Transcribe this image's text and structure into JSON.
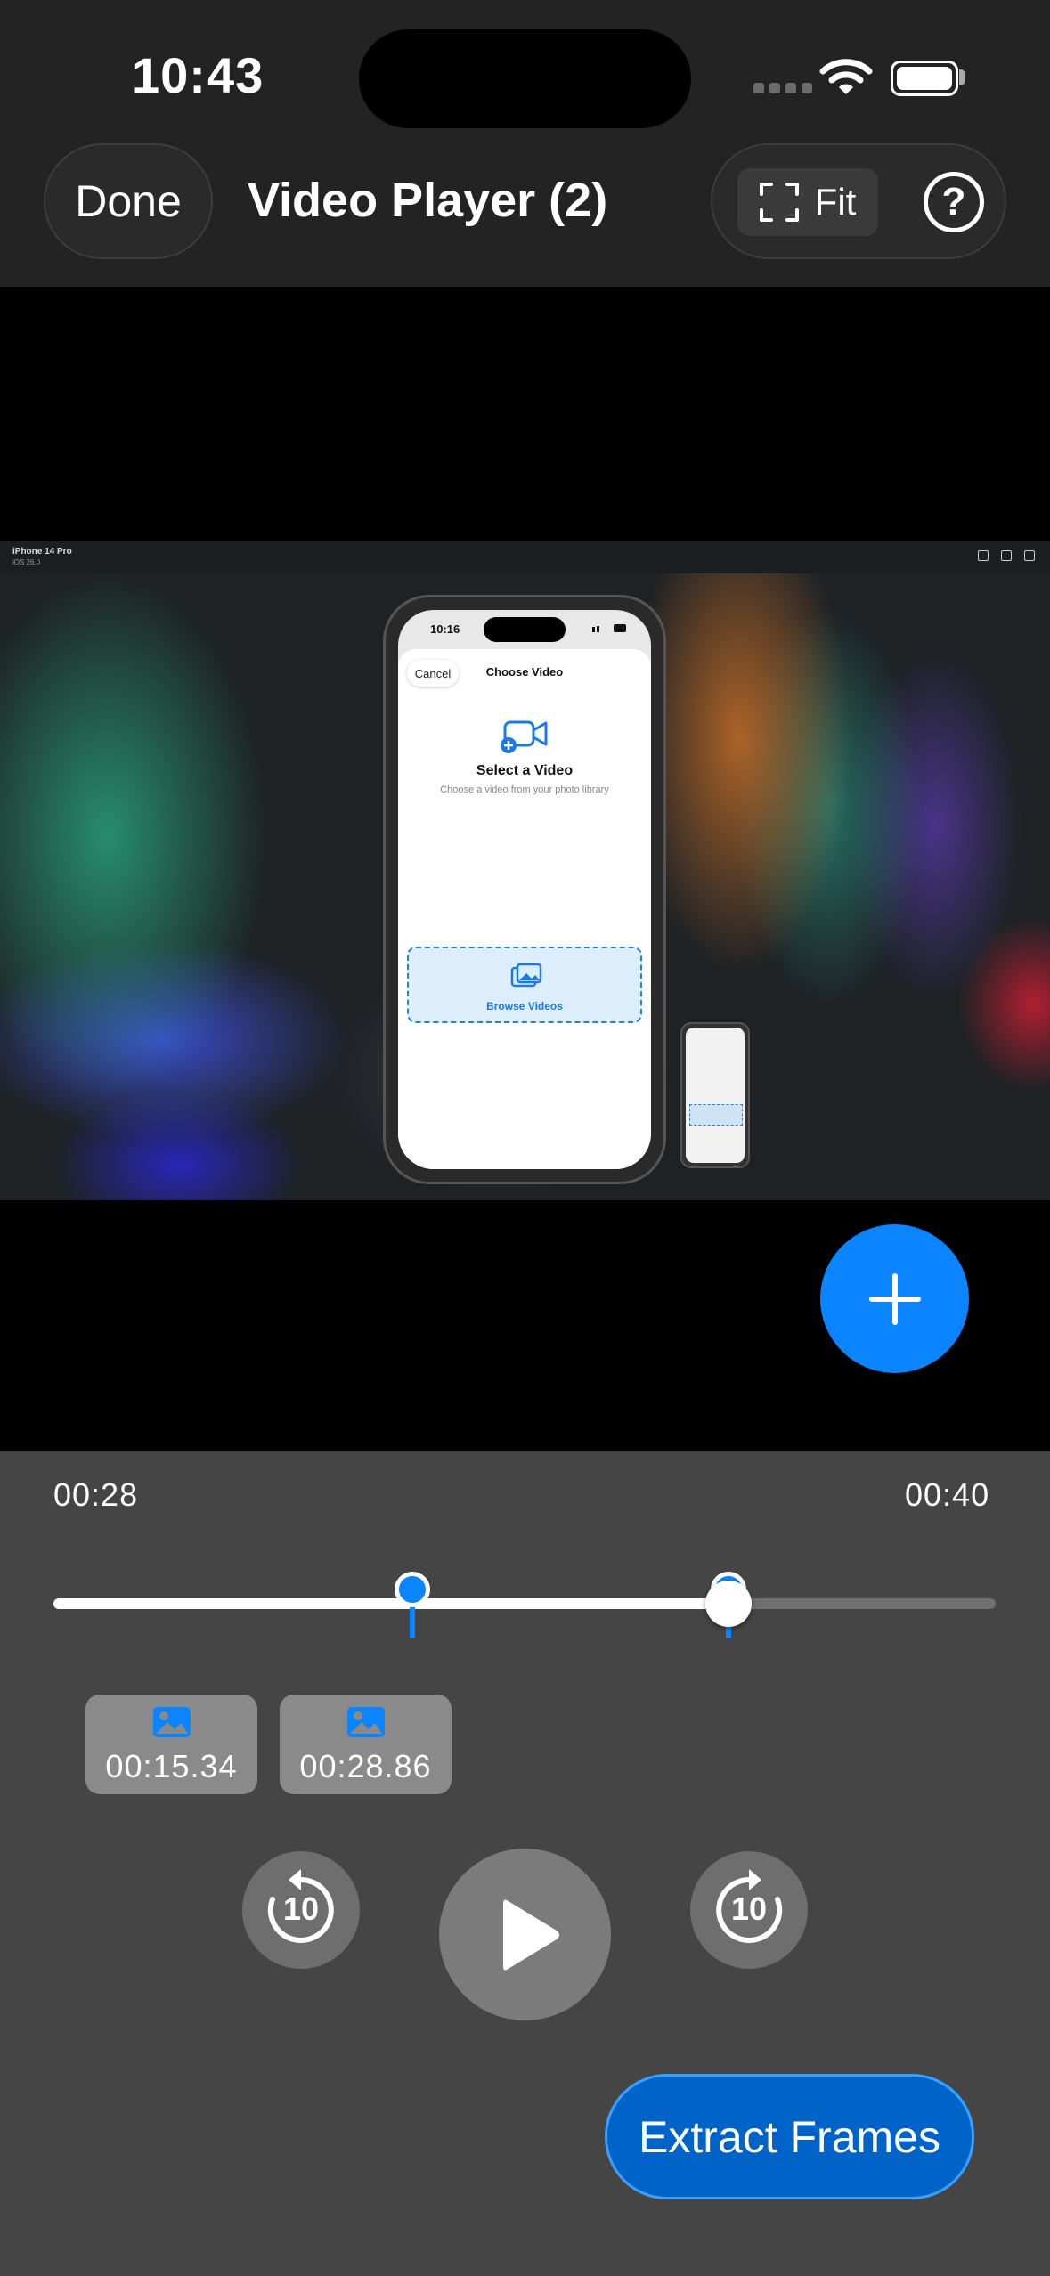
{
  "status_bar": {
    "time": "10:43"
  },
  "header": {
    "done_label": "Done",
    "title": "Video Player (2)",
    "fit_label": "Fit",
    "help_label": "?"
  },
  "video_frame": {
    "device_label": "iPhone 14 Pro",
    "os_label": "iOS 26.0",
    "phone": {
      "time": "10:16",
      "cancel_label": "Cancel",
      "sheet_title": "Choose Video",
      "heading": "Select a Video",
      "subheading": "Choose a video from your photo library",
      "browse_label": "Browse Videos"
    }
  },
  "add_button": {
    "icon": "plus-icon"
  },
  "timeline": {
    "current_time": "00:28",
    "total_time": "00:40",
    "progress_fraction": 0.7,
    "markers": [
      {
        "time": "00:15.34",
        "fraction": 0.38
      },
      {
        "time": "00:28.86",
        "fraction": 0.72
      }
    ]
  },
  "frames": [
    {
      "label": "00:15.34",
      "icon": "photo-icon"
    },
    {
      "label": "00:28.86",
      "icon": "photo-icon"
    }
  ],
  "playback": {
    "skip_back_label": "10",
    "skip_forward_label": "10",
    "play_icon": "play-icon"
  },
  "extract_label": "Extract Frames",
  "colors": {
    "accent": "#0a84ff",
    "extract": "#0063c7",
    "panel": "#454545"
  }
}
